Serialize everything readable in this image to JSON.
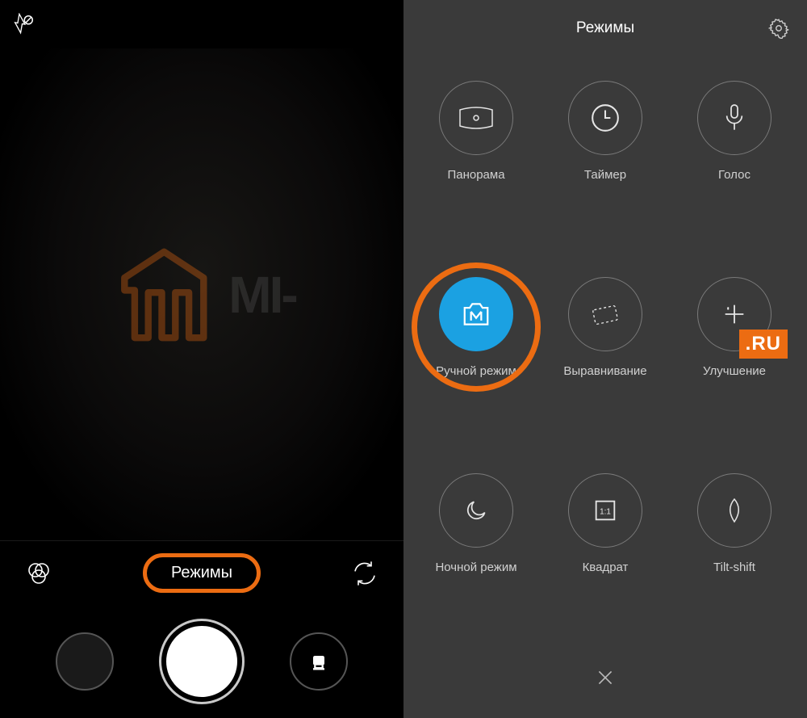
{
  "left": {
    "modes_label": "Режимы",
    "watermark_text": "MI-"
  },
  "right": {
    "title": "Режимы",
    "ru_badge": ".RU",
    "modes": [
      {
        "label": "Панорама"
      },
      {
        "label": "Таймер"
      },
      {
        "label": "Голос"
      },
      {
        "label": "Ручной режим"
      },
      {
        "label": "Выравнивание"
      },
      {
        "label": "Улучшение"
      },
      {
        "label": "Ночной режим"
      },
      {
        "label": "Квадрат"
      },
      {
        "label": "Tilt-shift"
      }
    ]
  }
}
